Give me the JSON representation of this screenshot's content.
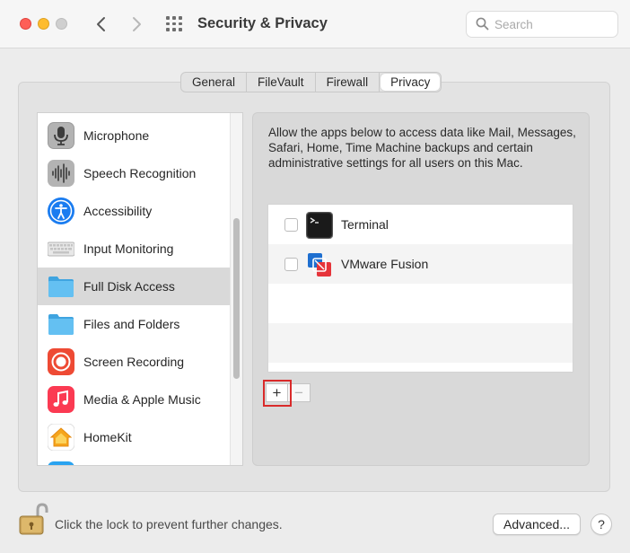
{
  "window": {
    "title": "Security & Privacy",
    "search_placeholder": "Search"
  },
  "tabs": [
    {
      "label": "General",
      "active": false
    },
    {
      "label": "FileVault",
      "active": false
    },
    {
      "label": "Firewall",
      "active": false
    },
    {
      "label": "Privacy",
      "active": true
    }
  ],
  "sidebar": {
    "items": [
      {
        "label": "Microphone",
        "icon": "microphone-icon",
        "selected": false
      },
      {
        "label": "Speech Recognition",
        "icon": "waveform-icon",
        "selected": false
      },
      {
        "label": "Accessibility",
        "icon": "accessibility-icon",
        "selected": false
      },
      {
        "label": "Input Monitoring",
        "icon": "keyboard-icon",
        "selected": false
      },
      {
        "label": "Full Disk Access",
        "icon": "folder-icon",
        "selected": true
      },
      {
        "label": "Files and Folders",
        "icon": "folder-icon",
        "selected": false
      },
      {
        "label": "Screen Recording",
        "icon": "screen-recording-icon",
        "selected": false
      },
      {
        "label": "Media & Apple Music",
        "icon": "music-icon",
        "selected": false
      },
      {
        "label": "HomeKit",
        "icon": "home-icon",
        "selected": false
      }
    ]
  },
  "panel": {
    "description": "Allow the apps below to access data like Mail, Messages, Safari, Home, Time Machine backups and certain administrative settings for all users on this Mac.",
    "apps": [
      {
        "label": "Terminal",
        "icon": "terminal-icon",
        "checked": false
      },
      {
        "label": "VMware Fusion",
        "icon": "vmware-fusion-icon",
        "checked": false
      }
    ],
    "add_label": "+",
    "remove_label": "−"
  },
  "footer": {
    "lock_text": "Click the lock to prevent further changes.",
    "advanced_label": "Advanced...",
    "help_label": "?"
  },
  "colors": {
    "highlight": "#d92a2a",
    "selected_row": "#d9d9d9",
    "accessibility_blue": "#1a7cf0",
    "folder_blue": "#58b8ee",
    "screen_recording_red": "#ee4a34",
    "music_red": "#fb3a52",
    "homekit_orange": "#f5a51d"
  }
}
